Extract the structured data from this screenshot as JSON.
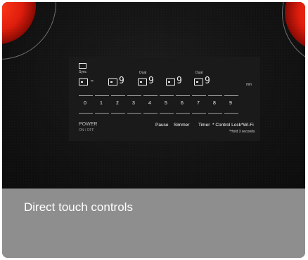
{
  "panel": {
    "sync_label": "Sync",
    "dual_label_1": "Dual",
    "dual_label_2": "Dual",
    "min_label": "min",
    "zone_digits": [
      "-",
      "9",
      "9",
      "9",
      "9",
      "9"
    ],
    "sliders": [
      "0",
      "1",
      "2",
      "3",
      "4",
      "5",
      "6",
      "7",
      "8",
      "9"
    ],
    "power_label": "POWER",
    "power_sub": "ON / OFF",
    "pause_label": "Pause",
    "simmer_label": "Simmer",
    "timer_label": "Timer",
    "control_lock_label": "* Control Lock",
    "wifi_label": "*Wi-Fi",
    "hold_note": "*Hold 3 seconds"
  },
  "caption": "Direct touch controls",
  "colors": {
    "burner": "#e01d0c",
    "glass": "#121212",
    "caption_band": "#8e8e8e"
  }
}
